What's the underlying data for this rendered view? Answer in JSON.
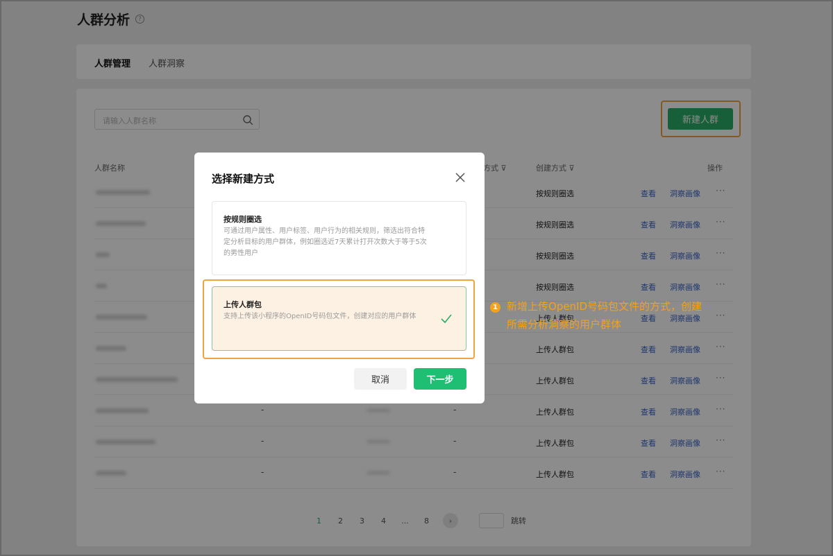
{
  "header": {
    "title": "人群分析",
    "help_icon": "?"
  },
  "tabs": [
    {
      "label": "人群管理",
      "active": true
    },
    {
      "label": "人群洞察",
      "active": false
    }
  ],
  "search": {
    "placeholder": "请输入人群名称"
  },
  "new_button": {
    "label": "新建人群"
  },
  "table": {
    "columns": [
      "人群名称",
      "方式",
      "创建方式",
      "操作"
    ],
    "rows": [
      {
        "created_by": "按规则圈选",
        "view": "查看",
        "insight": "洞察画像",
        "more": "···"
      },
      {
        "created_by": "按规则圈选",
        "view": "查看",
        "insight": "洞察画像",
        "more": "···"
      },
      {
        "created_by": "按规则圈选",
        "view": "查看",
        "insight": "洞察画像",
        "more": "···"
      },
      {
        "created_by": "按规则圈选",
        "view": "查看",
        "insight": "洞察画像",
        "more": "···"
      },
      {
        "created_by": "上传人群包",
        "view": "查看",
        "insight": "洞察画像",
        "more": "···"
      },
      {
        "created_by": "上传人群包",
        "view": "查看",
        "insight": "洞察画像",
        "more": "···"
      },
      {
        "created_by": "上传人群包",
        "view": "查看",
        "insight": "洞察画像",
        "more": "···"
      },
      {
        "col2": "-",
        "col4": "-",
        "created_by": "上传人群包",
        "view": "查看",
        "insight": "洞察画像",
        "more": "···"
      },
      {
        "col2": "-",
        "col4": "-",
        "created_by": "上传人群包",
        "view": "查看",
        "insight": "洞察画像",
        "more": "···"
      },
      {
        "col2": "-",
        "col4": "-",
        "created_by": "上传人群包",
        "view": "查看",
        "insight": "洞察画像",
        "more": "···"
      }
    ]
  },
  "pagination": {
    "pages": [
      "1",
      "2",
      "3",
      "4",
      "...",
      "8"
    ],
    "current": "1",
    "jump_label": "跳转"
  },
  "modal": {
    "title": "选择新建方式",
    "options": [
      {
        "title": "按规则圈选",
        "description": "可通过用户属性、用户标签、用户行为的相关规则，筛选出符合特定分析目标的用户群体，例如圈选近7天累计打开次数大于等于5次的男性用户",
        "selected": false
      },
      {
        "title": "上传人群包",
        "description": "支持上传该小程序的OpenID号码包文件，创建对应的用户群体",
        "selected": true
      }
    ],
    "cancel_label": "取消",
    "next_label": "下一步"
  },
  "annotation": {
    "badge": "1",
    "line1": "新增上传OpenID号码包文件的方式，创建",
    "line2": "所需分析洞察的用户群体"
  },
  "colors": {
    "primary_green": "#2aae67",
    "highlight_orange": "#f0a23c",
    "link_blue": "#3a64c8"
  }
}
